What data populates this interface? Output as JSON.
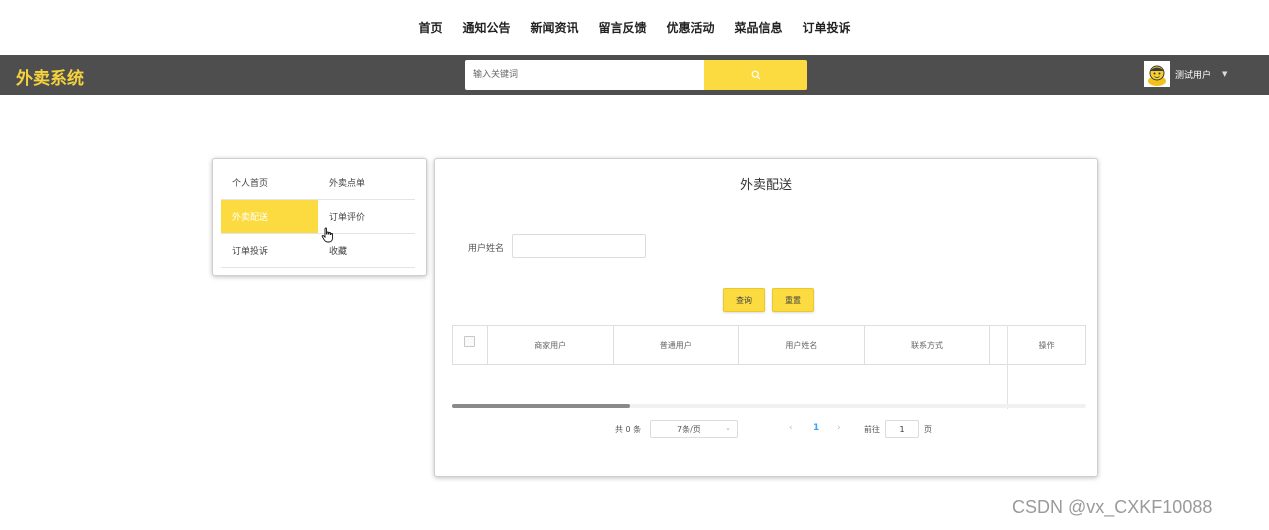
{
  "top_nav": {
    "items": [
      "首页",
      "通知公告",
      "新闻资讯",
      "留言反馈",
      "优惠活动",
      "菜品信息",
      "订单投诉"
    ]
  },
  "header": {
    "brand": "外卖系统",
    "search_placeholder": "输入关键词",
    "search_icon": "search-icon",
    "username": "测试用户",
    "user_caret": "▼",
    "bar_color": "#4e4e4e",
    "accent_color": "#fbdb3f"
  },
  "side_menu": {
    "items": [
      {
        "label": "个人首页",
        "active": false
      },
      {
        "label": "外卖点单",
        "active": false
      },
      {
        "label": "外卖配送",
        "active": true
      },
      {
        "label": "订单评价",
        "active": false
      },
      {
        "label": "订单投诉",
        "active": false
      },
      {
        "label": "收藏",
        "active": false
      }
    ]
  },
  "main": {
    "title": "外卖配送",
    "filter": {
      "label": "用户姓名",
      "value": ""
    },
    "buttons": {
      "query": "查询",
      "reset": "重置"
    },
    "table": {
      "columns": [
        "商家用户",
        "普通用户",
        "用户姓名",
        "联系方式",
        "操作"
      ],
      "rows": []
    },
    "pagination": {
      "total_text": "共 0 条",
      "page_size": "7条/页",
      "current_page": "1",
      "goto_label": "前往",
      "goto_value": "1",
      "page_unit": "页",
      "prev": "‹",
      "next": "›"
    }
  },
  "watermark": "CSDN @vx_CXKF10088"
}
